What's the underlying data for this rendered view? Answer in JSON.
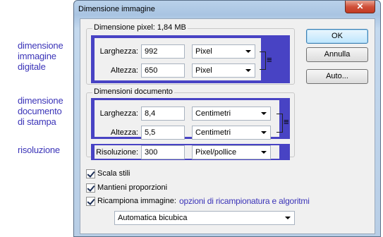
{
  "annotations": {
    "digital": "dimensione\nimmagine\ndigitale",
    "document": "dimensione\ndocumento\ndi stampa",
    "resolution": "risoluzione",
    "resample": "opzioni di ricampionatura e algoritmi"
  },
  "dialog": {
    "title": "Dimensione immagine",
    "close_glyph": "✕"
  },
  "pixel_dimensions": {
    "legend": "Dimensione pixel:  1,84 MB",
    "width_label": "Larghezza:",
    "width_value": "992",
    "width_unit": "Pixel",
    "height_label": "Altezza:",
    "height_value": "650",
    "height_unit": "Pixel"
  },
  "document_size": {
    "legend": "Dimensioni documento",
    "width_label": "Larghezza:",
    "width_value": "8,4",
    "width_unit": "Centimetri",
    "height_label": "Altezza:",
    "height_value": "5,5",
    "height_unit": "Centimetri",
    "resolution_label": "Risoluzione:",
    "resolution_value": "300",
    "resolution_unit": "Pixel/pollice"
  },
  "buttons": {
    "ok": "OK",
    "cancel": "Annulla",
    "auto": "Auto..."
  },
  "options": {
    "scale_styles": "Scala stili",
    "constrain_proportions": "Mantieni proporzioni",
    "resample_image": "Ricampiona immagine:",
    "resample_method": "Automatica bicubica"
  },
  "colors": {
    "annotation_blue": "#3b34b8",
    "highlight_bar": "#4843c4"
  }
}
